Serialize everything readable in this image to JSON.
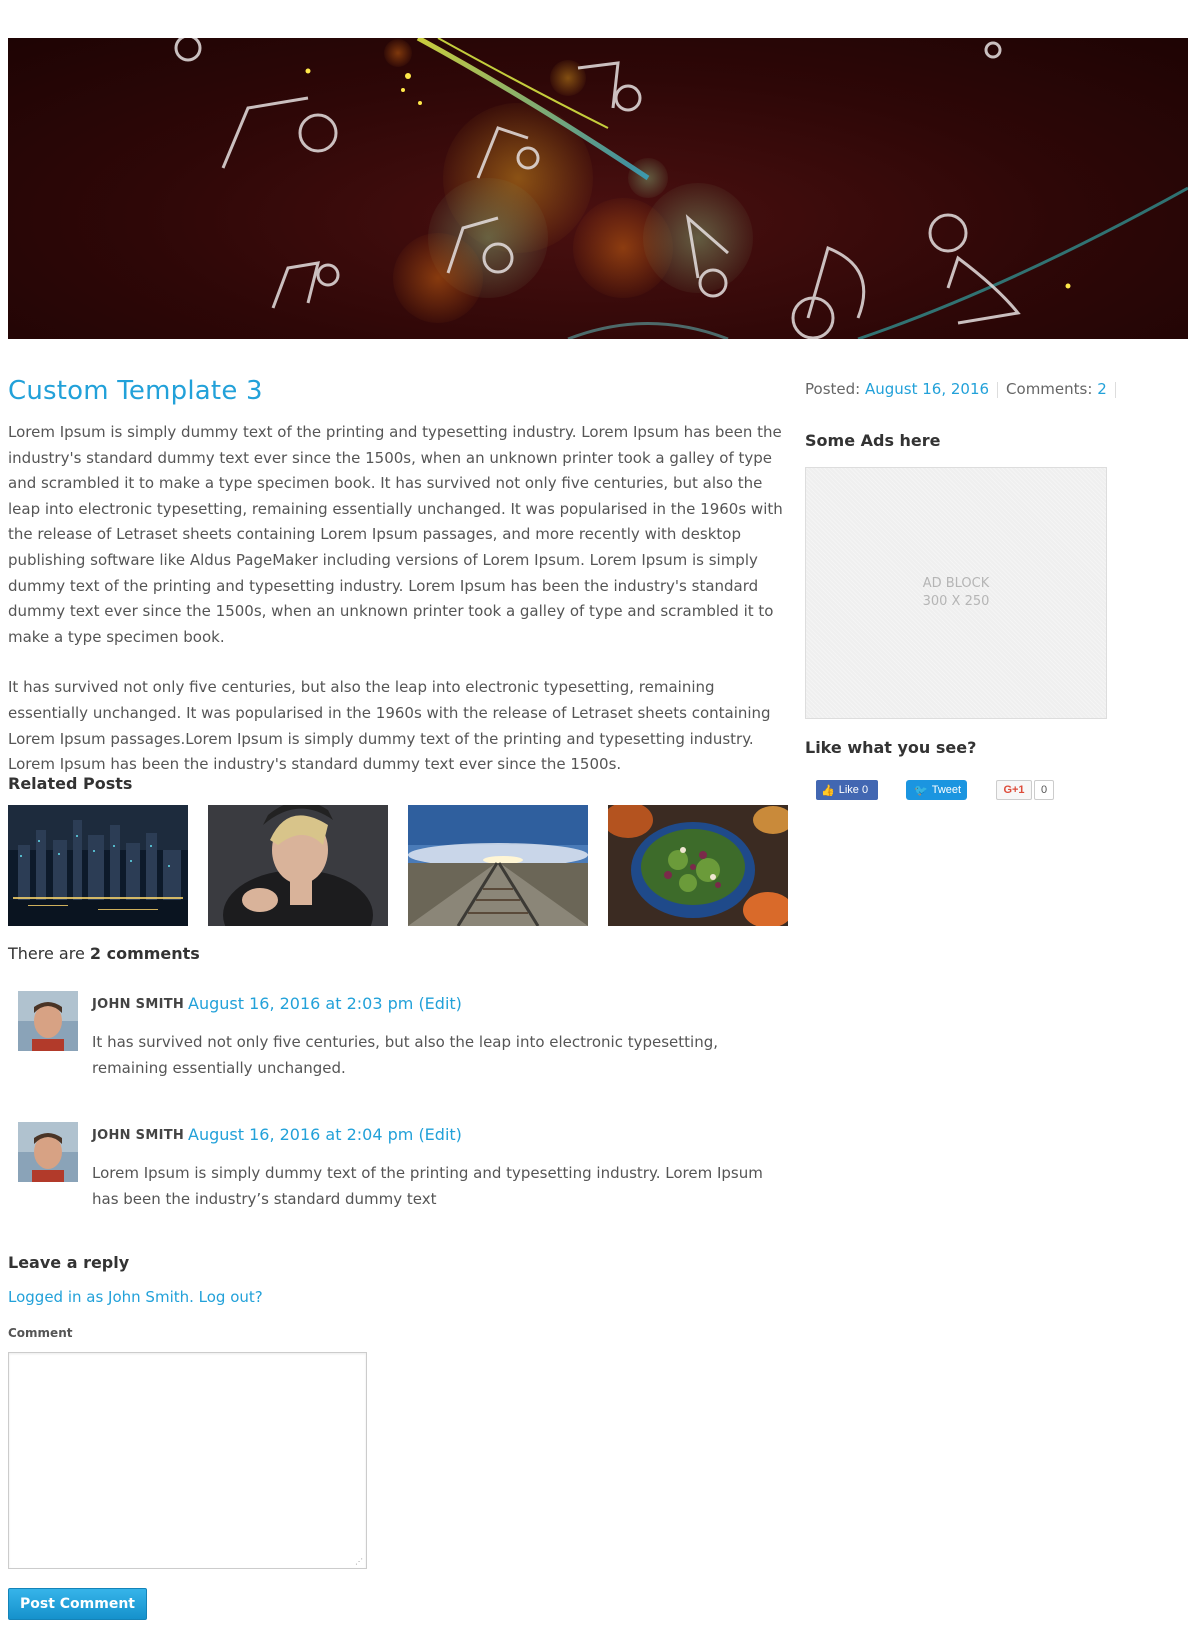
{
  "post": {
    "title": "Custom Template 3",
    "paragraphs": [
      "Lorem Ipsum is simply dummy text of the printing and typesetting industry. Lorem Ipsum has been the industry's standard dummy text ever since the 1500s, when an unknown printer took a galley of type and scrambled it to make a type specimen book. It has survived not only five centuries, but also the leap into electronic typesetting, remaining essentially unchanged. It was popularised in the 1960s with the release of Letraset sheets containing Lorem Ipsum passages, and more recently with desktop publishing software like Aldus PageMaker including versions of Lorem Ipsum. Lorem Ipsum is simply dummy text of the printing and typesetting industry. Lorem Ipsum has been the industry's standard dummy text ever since the 1500s, when an unknown printer took a galley of type and scrambled it to make a type specimen book.",
      "It has survived not only five centuries, but also the leap into electronic typesetting, remaining essentially unchanged. It was popularised in the 1960s with the release of Letraset sheets containing Lorem Ipsum passages.Lorem Ipsum is simply dummy text of the printing and typesetting industry. Lorem Ipsum has been the industry's standard dummy text ever since the 1500s."
    ]
  },
  "meta": {
    "posted_label": "Posted:",
    "posted_date": "August 16, 2016",
    "comments_label": "Comments:",
    "comments_count": "2"
  },
  "sidebar": {
    "ads_title": "Some Ads here",
    "ad_line1": "AD BLOCK",
    "ad_line2": "300 X 250",
    "like_title": "Like what you see?"
  },
  "share": {
    "facebook": "Like 0",
    "twitter": "Tweet",
    "gplus": "G+1",
    "gplus_count": "0"
  },
  "related": {
    "title": "Related Posts",
    "items": [
      "city-night-photo",
      "woman-fur-portrait-photo",
      "railway-tracks-photo",
      "salad-bowl-photo"
    ]
  },
  "comments": {
    "heading_prefix": "There are",
    "heading_count": "2 comments",
    "items": [
      {
        "author": "JOHN SMITH",
        "date": "August 16, 2016 at 2:03 pm",
        "edit": "(Edit)",
        "text": "It has survived not only five centuries, but also the leap into electronic typesetting, remaining essentially unchanged."
      },
      {
        "author": "JOHN SMITH",
        "date": "August 16, 2016 at 2:04 pm",
        "edit": "(Edit)",
        "text": "Lorem Ipsum is simply dummy text of the printing and typesetting industry. Lorem Ipsum has been the industry’s standard dummy text"
      }
    ]
  },
  "reply": {
    "title": "Leave a reply",
    "logged_in": "Logged in as John Smith. Log out?",
    "comment_label": "Comment",
    "comment_value": "",
    "submit": "Post Comment"
  },
  "colors": {
    "link": "#22a1d9",
    "banner_bg": "#2e0707",
    "button": "#1591cc"
  }
}
